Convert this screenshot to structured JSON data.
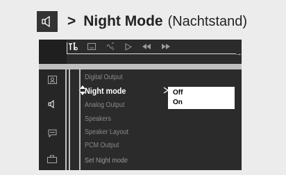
{
  "header": {
    "icon": "speaker-icon",
    "arrow": ">",
    "title": "Night Mode",
    "subtitle": "(Nachtstand)"
  },
  "topbar": {
    "tabs": [
      {
        "icon": "settings-tools-icon",
        "active": true
      },
      {
        "icon": "subtitle-icon",
        "active": false
      },
      {
        "icon": "audio-icon",
        "active": false
      },
      {
        "icon": "play-icon",
        "active": false
      },
      {
        "icon": "rewind-icon",
        "active": false
      },
      {
        "icon": "fast-forward-icon",
        "active": false
      }
    ]
  },
  "sidebar": {
    "icons": [
      "general-setup-icon",
      "audio-setup-icon",
      "language-setup-icon",
      "preferences-icon"
    ],
    "selected": "audio-setup-icon"
  },
  "menu": {
    "items": [
      "Digital Output",
      "Night mode",
      "Analog Output",
      "Speakers",
      "Speaker Layout",
      "PCM Output",
      "Set Night mode"
    ],
    "selected_index": 1
  },
  "options": {
    "items": [
      "Off",
      "On"
    ],
    "pointer": "Off"
  },
  "colors": {
    "screen_bg": "#2b2b2b",
    "frame": "#bfbfbf",
    "text_dim": "#8a8a8a",
    "text_bright": "#ffffff"
  }
}
